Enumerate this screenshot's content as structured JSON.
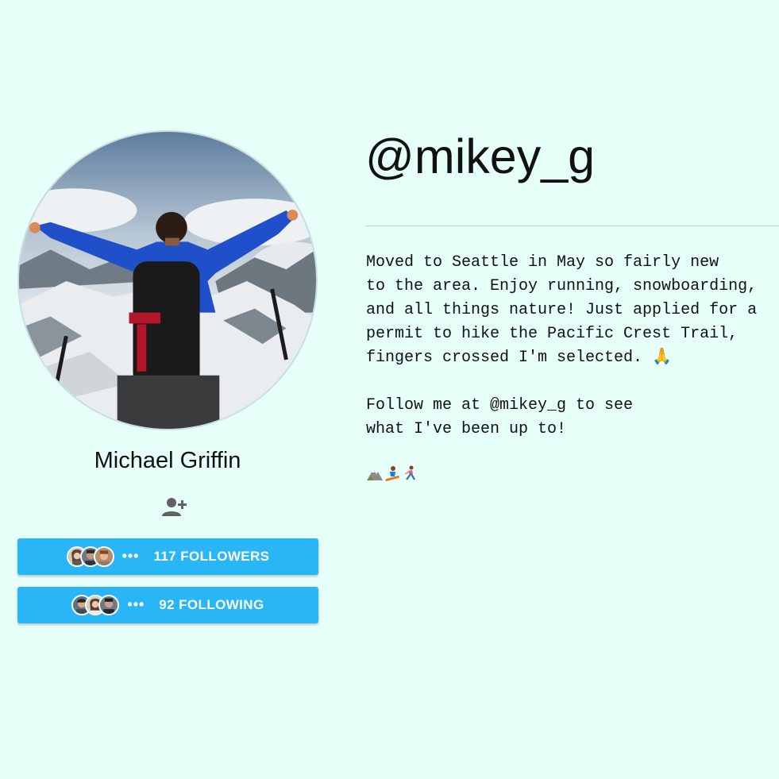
{
  "profile": {
    "handle": "@mikey_g",
    "display_name": "Michael Griffin",
    "bio_paragraph_1": [
      "Moved to Seattle in May so fairly new",
      "to the area. Enjoy running, snowboarding,",
      "and all things nature! Just applied for a",
      "permit to hike the Pacific Crest Trail,",
      "fingers crossed I'm selected. 🙏"
    ],
    "bio_paragraph_2": [
      "Follow me at @mikey_g to see",
      "what I've been up to!"
    ],
    "bio_emojis": [
      "mountain-icon",
      "snowboarder-icon",
      "runner-icon"
    ]
  },
  "followers_button": {
    "label": "117 FOLLOWERS",
    "dots": "•••"
  },
  "following_button": {
    "label": "92 FOLLOWING",
    "dots": "•••"
  },
  "icons": {
    "add_friend": "person-add-icon"
  },
  "colors": {
    "background": "#e6fff8",
    "button": "#29b6f6",
    "button_text": "#ffffff",
    "icon_gray": "#616161"
  }
}
